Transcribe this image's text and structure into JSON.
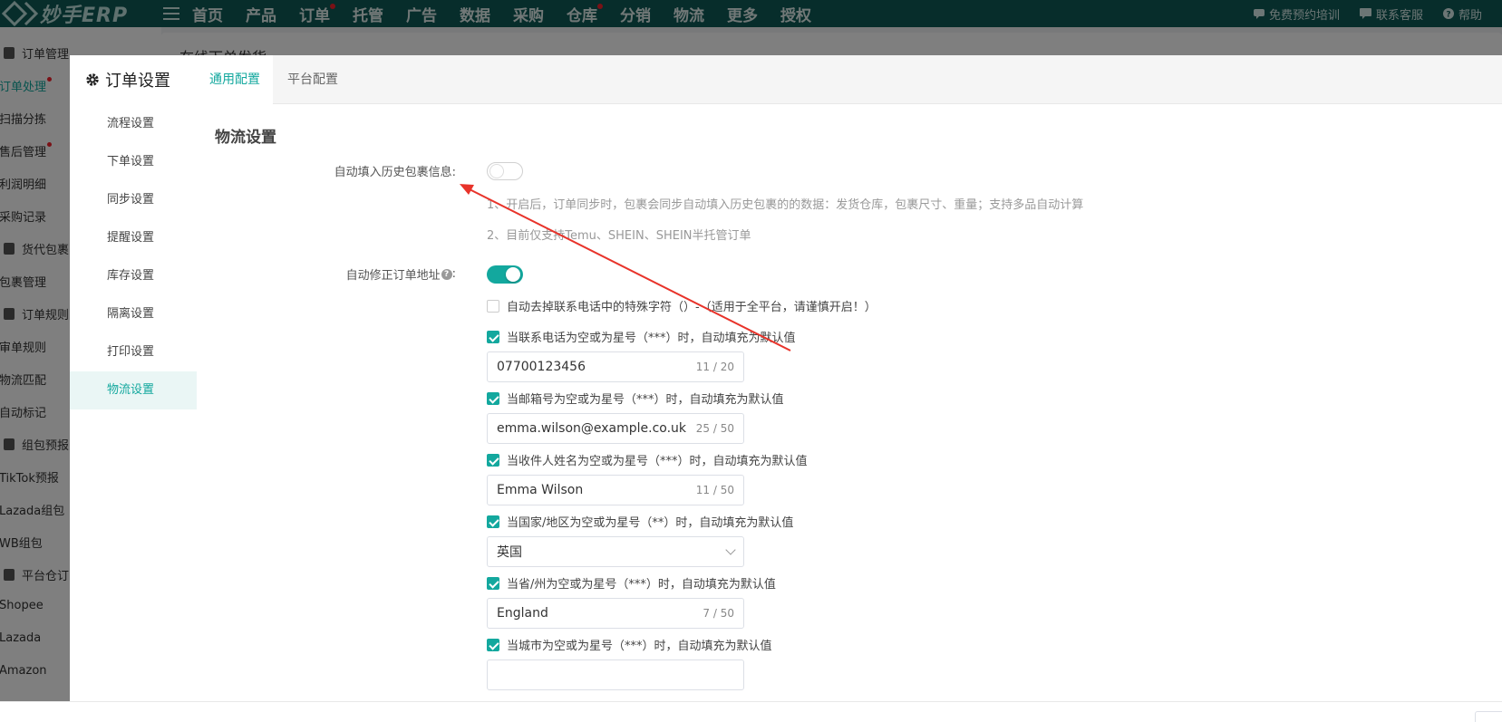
{
  "app": {
    "logo_text": "妙手ERP",
    "nav": [
      {
        "label": "首页",
        "dot": false
      },
      {
        "label": "产品",
        "dot": false
      },
      {
        "label": "订单",
        "dot": true
      },
      {
        "label": "托管",
        "dot": false
      },
      {
        "label": "广告",
        "dot": false
      },
      {
        "label": "数据",
        "dot": false
      },
      {
        "label": "采购",
        "dot": false
      },
      {
        "label": "仓库",
        "dot": true
      },
      {
        "label": "分销",
        "dot": false
      },
      {
        "label": "物流",
        "dot": false
      },
      {
        "label": "更多",
        "dot": false
      },
      {
        "label": "授权",
        "dot": false
      }
    ],
    "top_right": {
      "training": "免费预约培训",
      "support": "联系客服",
      "help": "帮助"
    }
  },
  "app_sidebar": {
    "items": [
      {
        "label": "订单管理",
        "group": true
      },
      {
        "label": "订单处理",
        "active": true,
        "dot": true
      },
      {
        "label": "扫描分拣"
      },
      {
        "label": "售后管理",
        "dot": true
      },
      {
        "label": "利润明细"
      },
      {
        "label": "采购记录"
      },
      {
        "label": "货代包裹",
        "group": true
      },
      {
        "label": "包裹管理"
      },
      {
        "label": "订单规则",
        "group": true
      },
      {
        "label": "审单规则"
      },
      {
        "label": "物流匹配"
      },
      {
        "label": "自动标记"
      },
      {
        "label": "组包预报",
        "group": true
      },
      {
        "label": "TikTok预报"
      },
      {
        "label": "Lazada组包"
      },
      {
        "label": "WB组包"
      },
      {
        "label": "平台仓订",
        "group": true
      },
      {
        "label": "Shopee"
      },
      {
        "label": "Lazada"
      },
      {
        "label": "Amazon"
      }
    ]
  },
  "background_panel": {
    "title": "在线下单发货"
  },
  "modal": {
    "title": "订单设置",
    "settings_menu": [
      {
        "label": "流程设置",
        "active": false
      },
      {
        "label": "下单设置",
        "active": false
      },
      {
        "label": "同步设置",
        "active": false
      },
      {
        "label": "提醒设置",
        "active": false
      },
      {
        "label": "库存设置",
        "active": false
      },
      {
        "label": "隔离设置",
        "active": false
      },
      {
        "label": "打印设置",
        "active": false
      },
      {
        "label": "物流设置",
        "active": true
      }
    ],
    "tabs": [
      {
        "label": "通用配置",
        "active": true
      },
      {
        "label": "平台配置",
        "active": false
      }
    ],
    "section_title": "物流设置",
    "auto_fill_history": {
      "label": "自动填入历史包裹信息:",
      "enabled": false,
      "notes": [
        "1、开启后，订单同步时，包裹会同步自动填入历史包裹的的数据：发货仓库，包裹尺寸、重量；支持多品自动计算",
        "2、目前仅支持Temu、SHEIN、SHEIN半托管订单"
      ]
    },
    "auto_fix_address": {
      "label": "自动修正订单地址",
      "help": "?",
      "colon": ":",
      "enabled": true,
      "options": [
        {
          "label": "自动去掉联系电话中的特殊字符（）-（适用于全平台，请谨慎开启！）",
          "checked": false
        },
        {
          "label": "当联系电话为空或为星号（***）时，自动填充为默认值",
          "checked": true,
          "input": {
            "value": "07700123456",
            "count": "11 / 20"
          }
        },
        {
          "label": "当邮箱号为空或为星号（***）时，自动填充为默认值",
          "checked": true,
          "input": {
            "value": "emma.wilson@example.co.uk",
            "count": "25 / 50"
          }
        },
        {
          "label": "当收件人姓名为空或为星号（***）时，自动填充为默认值",
          "checked": true,
          "input": {
            "value": "Emma Wilson",
            "count": "11 / 50"
          }
        },
        {
          "label": "当国家/地区为空或为星号（**）时，自动填充为默认值",
          "checked": true,
          "select": {
            "value": "英国"
          }
        },
        {
          "label": "当省/州为空或为星号（***）时，自动填充为默认值",
          "checked": true,
          "input": {
            "value": "England",
            "count": "7 / 50"
          }
        },
        {
          "label": "当城市为空或为星号（***）时，自动填充为默认值",
          "checked": true
        }
      ]
    }
  },
  "colors": {
    "topbar": "#0e5a57",
    "accent": "#13a89e",
    "annotation_arrow": "#e8332a",
    "badge_dot": "#f5222d"
  }
}
